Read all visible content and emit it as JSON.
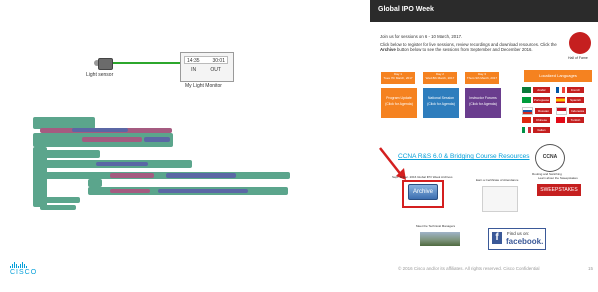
{
  "canvas": {
    "sensor_label": "Light sensor",
    "monitor": {
      "time": "14:35",
      "value": "30:01",
      "in_label": "IN",
      "out_label": "OUT",
      "name": "My Light Monitor"
    }
  },
  "brand": {
    "logo_text": "CISCO",
    "color": "#049fd9"
  },
  "panel": {
    "title": "Global IPO Week",
    "intro_line1": "Join us for sessions on 6 - 10 March, 2017.",
    "intro_line2_pre": "Click below to register for live sessions, review recordings and download resources. Click the ",
    "intro_bold": "Archive",
    "intro_line2_post": " button below to see the sessions from September and December 2016.",
    "hall_of_fame": "Hall of Fame",
    "days": [
      {
        "label": "Day 1",
        "date": "Tues 7th March, 2017"
      },
      {
        "label": "Day 2",
        "date": "Wed 8th March, 2017"
      },
      {
        "label": "Day 3",
        "date": "Thurs 9th March, 2017"
      }
    ],
    "tracks": [
      {
        "name": "Program Update",
        "link": "(Click for Agenda)",
        "color": "#f58220"
      },
      {
        "name": "National Session",
        "link": "(Click for Agenda)",
        "color": "#2e7dbd"
      },
      {
        "name": "Instructor Forums",
        "link": "(Click for Agenda)",
        "color": "#6a3d8e"
      }
    ],
    "localized_title": "Localized Languages",
    "languages_left": [
      {
        "name": "Arabic",
        "flag_color": "#0a7a3a"
      },
      {
        "name": "Portuguese",
        "flag_color": "#009c3b"
      },
      {
        "name": "Russian",
        "flag_color": "#1c57a7"
      },
      {
        "name": "Chinese",
        "flag_color": "#de2910"
      },
      {
        "name": "Italian",
        "flag_color": "#009246"
      }
    ],
    "languages_right": [
      {
        "name": "French",
        "flag_color": "#0055a4"
      },
      {
        "name": "Spanish",
        "flag_color": "#c60b1e"
      },
      {
        "name": "Indonesia",
        "flag_color": "#ce1126"
      },
      {
        "name": "Turkish",
        "flag_color": "#e30a17"
      }
    ],
    "ccna_title": "CCNA R&S 6.0 & Bridging Course Resources",
    "ccna_badge": "CCNA",
    "ccna_sub": "Routing and Switching",
    "archive_caption": "Sept. & Dec. 2016 Global IPO Week Archives",
    "archive_button": "Archive",
    "cert_caption": "Earn a Certificate of Attendance",
    "sweep_caption": "Learn about the Sweepstakes",
    "sweep_button": "SWEEPSTAKES",
    "tech_caption": "Meet the Technical Managers",
    "fb_find": "Find us on:",
    "fb_name": "facebook.",
    "footer": "© 2016 Cisco and/or its affiliates. All rights reserved. Cisco Confidential",
    "page_number": "15"
  }
}
